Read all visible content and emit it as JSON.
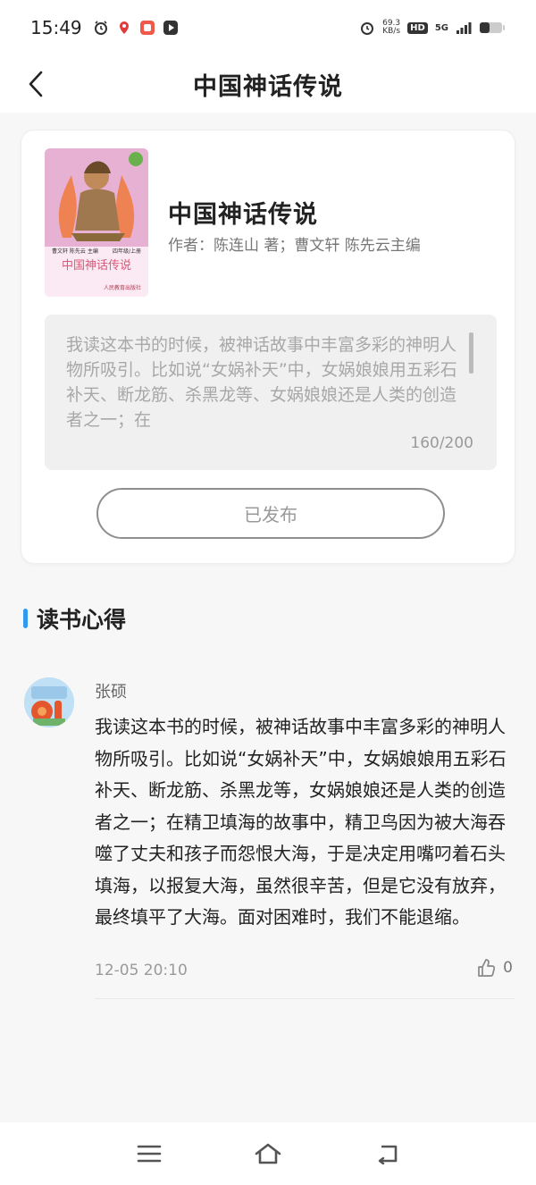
{
  "status_bar": {
    "time": "15:49",
    "net_speed_value": "69.3",
    "net_speed_unit": "KB/s",
    "hd_label": "HD",
    "network": "5G",
    "left_icons": [
      "alarm-icon",
      "location-icon",
      "app-icon",
      "media-icon"
    ],
    "right_icons": [
      "alarm-icon",
      "signal-icon",
      "battery-icon"
    ]
  },
  "header": {
    "title": "中国神话传说",
    "back_icon": "chevron-left-icon"
  },
  "book": {
    "title": "中国神话传说",
    "author": "作者：陈连山 著；曹文轩 陈先云主编",
    "cover_title": "中国神话传说",
    "cover_editors": "曹文轩 陈先云 主编",
    "cover_grade": "四年级/上册",
    "cover_publisher": "人民教育出版社"
  },
  "excerpt": {
    "text": "我读这本书的时候，被神话故事中丰富多彩的神明人物所吸引。比如说“女娲补天”中，女娲娘娘用五彩石补天、断龙筋、杀黑龙等、女娲娘娘还是人类的创造者之一；在",
    "count": "160/200"
  },
  "publish_button": {
    "label": "已发布"
  },
  "section": {
    "title": "读书心得"
  },
  "comment": {
    "user": "张硕",
    "body": "我读这本书的时候，被神话故事中丰富多彩的神明人物所吸引。比如说“女娲补天”中，女娲娘娘用五彩石补天、断龙筋、杀黑龙等，女娲娘娘还是人类的创造者之一；在精卫填海的故事中，精卫鸟因为被大海吞噬了丈夫和孩子而怨恨大海，于是决定用嘴叼着石头填海，以报复大海，虽然很辛苦，但是它没有放弃，最终填平了大海。面对困难时，我们不能退缩。",
    "time": "12-05 20:10",
    "likes": "0",
    "like_icon": "thumbs-up-icon"
  },
  "nav_bar": {
    "icons": [
      "menu-icon",
      "home-icon",
      "back-icon"
    ]
  },
  "colors": {
    "accent": "#2f9af0",
    "page_bg": "#f7f7f7",
    "box_bg": "#f0f0f0"
  }
}
